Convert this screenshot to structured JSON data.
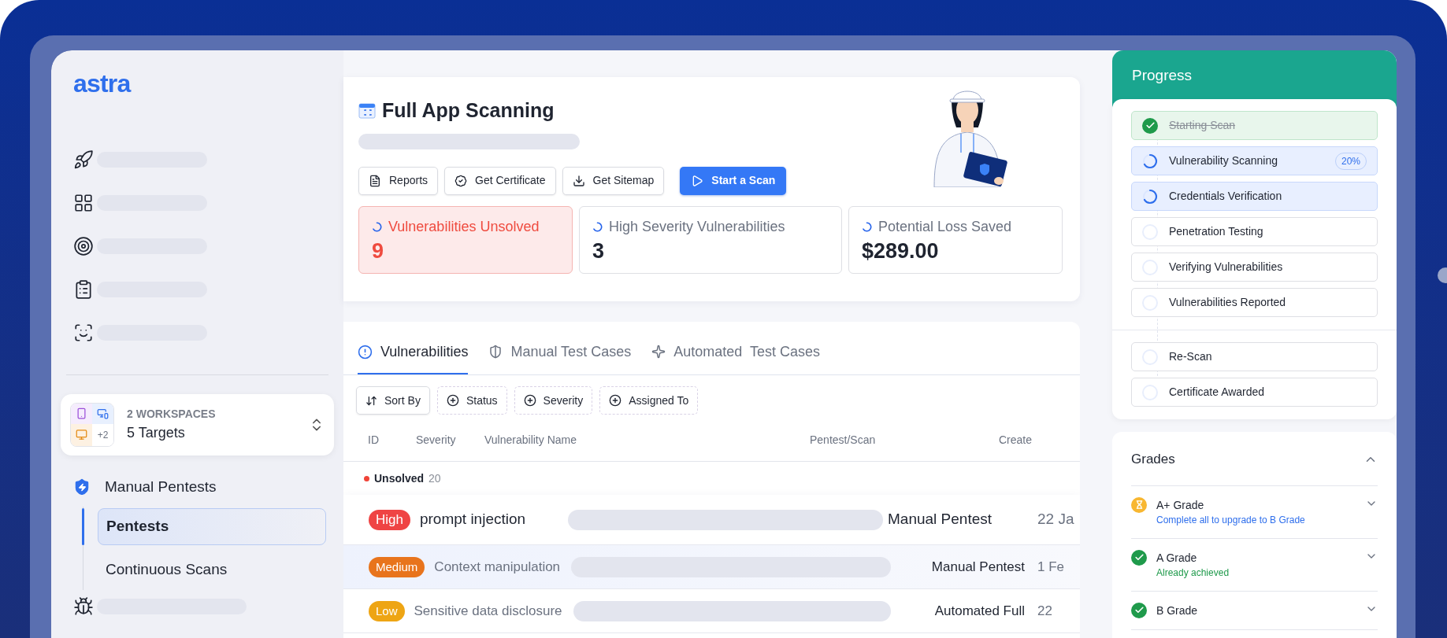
{
  "sidebar": {
    "logo": "astra",
    "workspace": {
      "count_label": "2 WORKSPACES",
      "targets": "5 Targets",
      "more": "+2"
    },
    "sections": [
      {
        "label": "Manual Pentests",
        "children": [
          {
            "label": "Pentests",
            "selected": true
          },
          {
            "label": "Continuous Scans",
            "selected": false
          }
        ]
      }
    ]
  },
  "scan": {
    "title": "Full App Scanning",
    "actions": [
      {
        "label": "Reports",
        "kind": "report"
      },
      {
        "label": "Get Certificate",
        "kind": "certificate"
      },
      {
        "label": "Get Sitemap",
        "kind": "download"
      },
      {
        "label": "Start a Scan",
        "kind": "primary"
      }
    ],
    "stats": [
      {
        "label": "Vulnerabilities Unsolved",
        "value": "9",
        "highlighted": true
      },
      {
        "label": "High Severity Vulnerabilities",
        "value": "3",
        "highlighted": false
      },
      {
        "label": "Potential Loss Saved",
        "value": "$289.00",
        "highlighted": false
      }
    ]
  },
  "findings": {
    "tabs": [
      {
        "label": "Vulnerabilities",
        "kind": "alert",
        "selected": true
      },
      {
        "label": "Manual Test Cases",
        "kind": "shield",
        "selected": false
      },
      {
        "label": "Automated  Test Cases",
        "kind": "sparkle",
        "selected": false
      }
    ],
    "filters": [
      {
        "label": "Sort By",
        "kind": "sort"
      },
      {
        "label": "Status",
        "kind": "add"
      },
      {
        "label": "Severity",
        "kind": "add"
      },
      {
        "label": "Assigned To",
        "kind": "add"
      }
    ],
    "columns": [
      "ID",
      "Severity",
      "Vulnerability Name",
      "Pentest/Scan",
      "Create"
    ],
    "group": {
      "label": "Unsolved",
      "count": "20",
      "color": "#f04438"
    },
    "rows": [
      {
        "severity": "High",
        "color": "#ef4444",
        "name": "prompt injection",
        "pentest": "Manual Pentest",
        "created": "22 Ja",
        "kind": "raised"
      },
      {
        "severity": "Medium",
        "color": "#e8741c",
        "name": "Context manipulation",
        "pentest": "Manual Pentest",
        "created": "1 Fe",
        "kind": "highlighted"
      },
      {
        "severity": "Low",
        "color": "#eea514",
        "name": "Sensitive data disclosure",
        "pentest": "Automated Full",
        "created": "22",
        "kind": "plain"
      }
    ]
  },
  "progress": {
    "title": "Progress",
    "steps": [
      {
        "label": "Starting Scan",
        "kind": "done"
      },
      {
        "label": "Vulnerability Scanning",
        "kind": "active",
        "badge": "20%"
      },
      {
        "label": "Credentials Verification",
        "kind": "active"
      },
      {
        "label": "Penetration Testing",
        "kind": "pending"
      },
      {
        "label": "Verifying Vulnerabilities",
        "kind": "pending"
      },
      {
        "label": "Vulnerabilities Reported",
        "kind": "pending"
      }
    ],
    "final_steps": [
      {
        "label": "Re-Scan",
        "kind": "pending"
      },
      {
        "label": "Certificate Awarded",
        "kind": "pending"
      }
    ]
  },
  "grades": {
    "title": "Grades",
    "expanded": true,
    "items": [
      {
        "label": "A+ Grade",
        "kind": "pending",
        "note": "Complete all to upgrade to B Grade",
        "expanded": false
      },
      {
        "label": "A Grade",
        "kind": "achieved",
        "note": "Already achieved",
        "expanded": false
      },
      {
        "label": "B Grade",
        "kind": "achieved",
        "expanded": false
      }
    ]
  }
}
